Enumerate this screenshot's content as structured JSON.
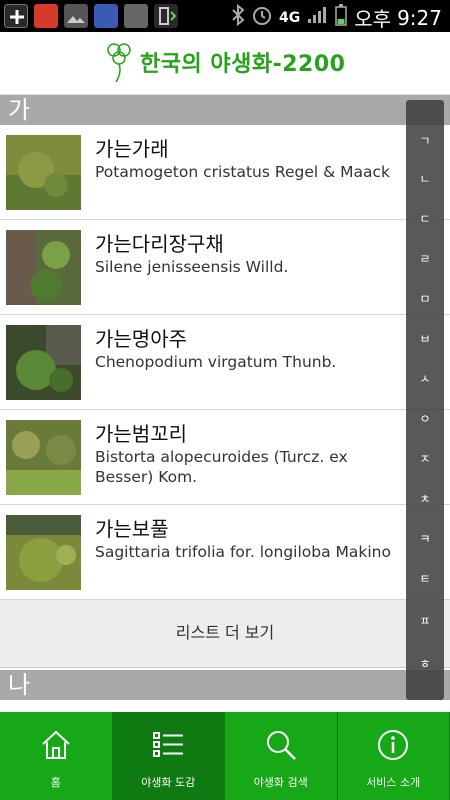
{
  "status": {
    "carrier": "오후",
    "time": "9:27",
    "network": "4G"
  },
  "header": {
    "title": "한국의 야생화-2200"
  },
  "sections": [
    {
      "label": "가"
    },
    {
      "label": "나"
    }
  ],
  "plants": [
    {
      "korean": "가는가래",
      "scientific": "Potamogeton cristatus Regel & Maack"
    },
    {
      "korean": "가는다리장구채",
      "scientific": "Silene jenisseensis Willd."
    },
    {
      "korean": "가는명아주",
      "scientific": "Chenopodium virgatum Thunb."
    },
    {
      "korean": "가는범꼬리",
      "scientific": "Bistorta alopecuroides (Turcz. ex Besser) Kom."
    },
    {
      "korean": "가는보풀",
      "scientific": "Sagittaria trifolia for. longiloba Makino"
    }
  ],
  "more": {
    "label": "리스트 더 보기"
  },
  "index": [
    "ㄱ",
    "ㄴ",
    "ㄷ",
    "ㄹ",
    "ㅁ",
    "ㅂ",
    "ㅅ",
    "ㅇ",
    "ㅈ",
    "ㅊ",
    "ㅋ",
    "ㅌ",
    "ㅍ",
    "ㅎ"
  ],
  "tabs": [
    {
      "label": "홈",
      "icon": "home-icon"
    },
    {
      "label": "야생화 도감",
      "icon": "list-icon"
    },
    {
      "label": "야생화 검색",
      "icon": "search-icon"
    },
    {
      "label": "서비스 소개",
      "icon": "info-icon"
    }
  ],
  "colors": {
    "brand_green": "#16a817",
    "active_tab": "#0f7a12",
    "section_bg": "#a9a9a9"
  }
}
